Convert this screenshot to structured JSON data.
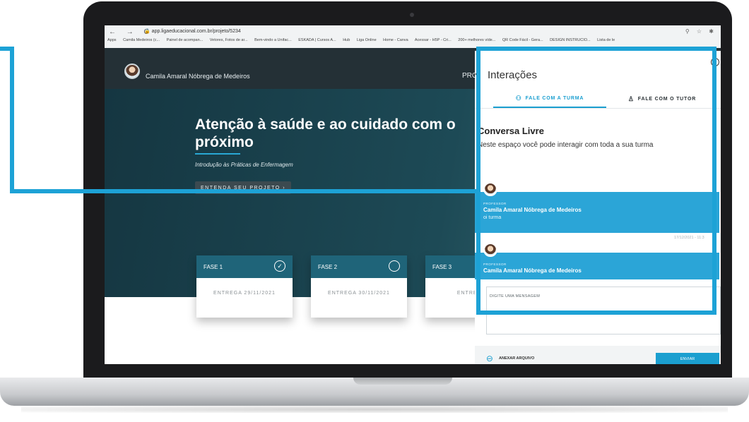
{
  "browser": {
    "nav": "← → C",
    "url": "app.ligaeducacional.com.br/projeto/5234",
    "bookmarks": [
      "Apps",
      "Camila Medeiros (c...",
      "Painel de acompan...",
      "Vetores, Fotos de ar...",
      "Bem-vindo a Unifac...",
      "ESKADA | Cursos A...",
      "Hub",
      "Liga Online",
      "Home - Canva",
      "Acessar - H5P - Cri...",
      "200+ melhores víde...",
      "QR Code Fácil - Gera...",
      "DESIGN INSTRUCIO...",
      "Lista de le"
    ],
    "right_icons": "⚲ ☆ ✱"
  },
  "header": {
    "user_name": "Camila Amaral Nóbrega de Medeiros",
    "nav_partial": "PRC"
  },
  "hero": {
    "title": "Atenção à saúde e ao cuidado com o próximo",
    "subtitle": "Introdução às Práticas de Enfermagem",
    "button_label": "ENTENDA SEU PROJETO ›"
  },
  "phases": [
    {
      "label": "FASE 1",
      "delivery": "ENTREGA 29/11/2021",
      "done": true
    },
    {
      "label": "FASE 2",
      "delivery": "ENTREGA 30/11/2021",
      "done": false
    },
    {
      "label": "FASE 3",
      "delivery": "ENTREGA :",
      "done": false
    }
  ],
  "panel": {
    "back_icon": "‹",
    "title": "Interações",
    "tabs": [
      {
        "label": "FALE COM A TURMA",
        "icon": "group-icon",
        "active": true
      },
      {
        "label": "FALE COM O TUTOR",
        "icon": "person-icon",
        "active": false
      }
    ],
    "conversation_title": "Conversa Livre",
    "conversation_desc": "Neste espaço você pode interagir com toda a sua turma",
    "messages": [
      {
        "role": "PROFESSOR",
        "name": "Camila Amaral Nóbrega de Medeiros",
        "text": "oi turma",
        "time": "17/12/2021 - 11:3"
      },
      {
        "role": "PROFESSOR",
        "name": "Camila Amaral Nóbrega de Medeiros",
        "text": "",
        "time": ""
      }
    ],
    "input_placeholder": "DIGITE UMA MENSAGEM",
    "attach_label": "ANEXAR ARQUIVO",
    "send_label": "ENVIAR"
  },
  "colors": {
    "accent": "#1da2d6",
    "hero_bg": "#153641",
    "phase_header": "#1f6479",
    "message_bg": "#2ba5d7"
  }
}
